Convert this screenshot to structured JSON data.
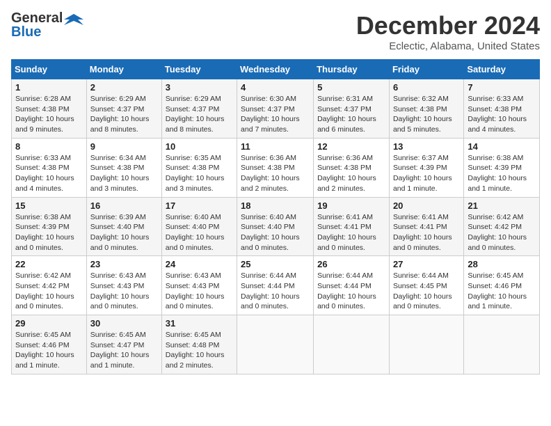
{
  "header": {
    "logo_general": "General",
    "logo_blue": "Blue",
    "month_title": "December 2024",
    "location": "Eclectic, Alabama, United States"
  },
  "days_of_week": [
    "Sunday",
    "Monday",
    "Tuesday",
    "Wednesday",
    "Thursday",
    "Friday",
    "Saturday"
  ],
  "weeks": [
    [
      {
        "day": "1",
        "sunrise": "6:28 AM",
        "sunset": "4:38 PM",
        "daylight": "10 hours and 9 minutes."
      },
      {
        "day": "2",
        "sunrise": "6:29 AM",
        "sunset": "4:37 PM",
        "daylight": "10 hours and 8 minutes."
      },
      {
        "day": "3",
        "sunrise": "6:29 AM",
        "sunset": "4:37 PM",
        "daylight": "10 hours and 8 minutes."
      },
      {
        "day": "4",
        "sunrise": "6:30 AM",
        "sunset": "4:37 PM",
        "daylight": "10 hours and 7 minutes."
      },
      {
        "day": "5",
        "sunrise": "6:31 AM",
        "sunset": "4:37 PM",
        "daylight": "10 hours and 6 minutes."
      },
      {
        "day": "6",
        "sunrise": "6:32 AM",
        "sunset": "4:38 PM",
        "daylight": "10 hours and 5 minutes."
      },
      {
        "day": "7",
        "sunrise": "6:33 AM",
        "sunset": "4:38 PM",
        "daylight": "10 hours and 4 minutes."
      }
    ],
    [
      {
        "day": "8",
        "sunrise": "6:33 AM",
        "sunset": "4:38 PM",
        "daylight": "10 hours and 4 minutes."
      },
      {
        "day": "9",
        "sunrise": "6:34 AM",
        "sunset": "4:38 PM",
        "daylight": "10 hours and 3 minutes."
      },
      {
        "day": "10",
        "sunrise": "6:35 AM",
        "sunset": "4:38 PM",
        "daylight": "10 hours and 3 minutes."
      },
      {
        "day": "11",
        "sunrise": "6:36 AM",
        "sunset": "4:38 PM",
        "daylight": "10 hours and 2 minutes."
      },
      {
        "day": "12",
        "sunrise": "6:36 AM",
        "sunset": "4:38 PM",
        "daylight": "10 hours and 2 minutes."
      },
      {
        "day": "13",
        "sunrise": "6:37 AM",
        "sunset": "4:39 PM",
        "daylight": "10 hours and 1 minute."
      },
      {
        "day": "14",
        "sunrise": "6:38 AM",
        "sunset": "4:39 PM",
        "daylight": "10 hours and 1 minute."
      }
    ],
    [
      {
        "day": "15",
        "sunrise": "6:38 AM",
        "sunset": "4:39 PM",
        "daylight": "10 hours and 0 minutes."
      },
      {
        "day": "16",
        "sunrise": "6:39 AM",
        "sunset": "4:40 PM",
        "daylight": "10 hours and 0 minutes."
      },
      {
        "day": "17",
        "sunrise": "6:40 AM",
        "sunset": "4:40 PM",
        "daylight": "10 hours and 0 minutes."
      },
      {
        "day": "18",
        "sunrise": "6:40 AM",
        "sunset": "4:40 PM",
        "daylight": "10 hours and 0 minutes."
      },
      {
        "day": "19",
        "sunrise": "6:41 AM",
        "sunset": "4:41 PM",
        "daylight": "10 hours and 0 minutes."
      },
      {
        "day": "20",
        "sunrise": "6:41 AM",
        "sunset": "4:41 PM",
        "daylight": "10 hours and 0 minutes."
      },
      {
        "day": "21",
        "sunrise": "6:42 AM",
        "sunset": "4:42 PM",
        "daylight": "10 hours and 0 minutes."
      }
    ],
    [
      {
        "day": "22",
        "sunrise": "6:42 AM",
        "sunset": "4:42 PM",
        "daylight": "10 hours and 0 minutes."
      },
      {
        "day": "23",
        "sunrise": "6:43 AM",
        "sunset": "4:43 PM",
        "daylight": "10 hours and 0 minutes."
      },
      {
        "day": "24",
        "sunrise": "6:43 AM",
        "sunset": "4:43 PM",
        "daylight": "10 hours and 0 minutes."
      },
      {
        "day": "25",
        "sunrise": "6:44 AM",
        "sunset": "4:44 PM",
        "daylight": "10 hours and 0 minutes."
      },
      {
        "day": "26",
        "sunrise": "6:44 AM",
        "sunset": "4:44 PM",
        "daylight": "10 hours and 0 minutes."
      },
      {
        "day": "27",
        "sunrise": "6:44 AM",
        "sunset": "4:45 PM",
        "daylight": "10 hours and 0 minutes."
      },
      {
        "day": "28",
        "sunrise": "6:45 AM",
        "sunset": "4:46 PM",
        "daylight": "10 hours and 1 minute."
      }
    ],
    [
      {
        "day": "29",
        "sunrise": "6:45 AM",
        "sunset": "4:46 PM",
        "daylight": "10 hours and 1 minute."
      },
      {
        "day": "30",
        "sunrise": "6:45 AM",
        "sunset": "4:47 PM",
        "daylight": "10 hours and 1 minute."
      },
      {
        "day": "31",
        "sunrise": "6:45 AM",
        "sunset": "4:48 PM",
        "daylight": "10 hours and 2 minutes."
      },
      null,
      null,
      null,
      null
    ]
  ],
  "labels": {
    "sunrise": "Sunrise:",
    "sunset": "Sunset:",
    "daylight": "Daylight:"
  }
}
